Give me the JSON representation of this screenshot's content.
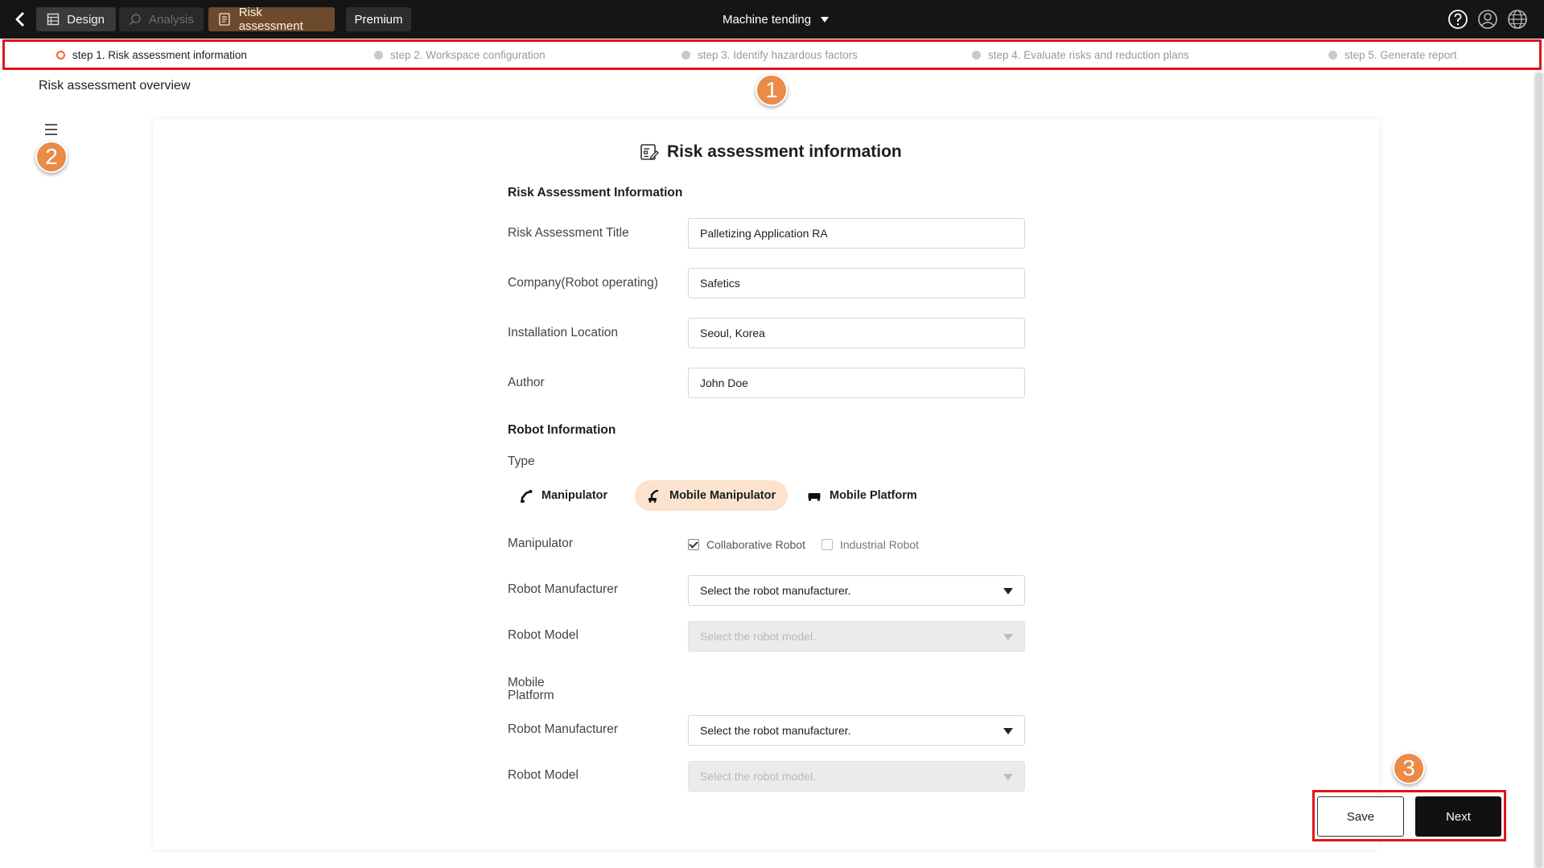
{
  "topbar": {
    "tabs": [
      {
        "label": "Design",
        "icon": "design-grid-icon"
      },
      {
        "label": "Analysis",
        "icon": "analysis-magnifier-icon"
      },
      {
        "label": "Risk assessment",
        "icon": "document-icon"
      },
      {
        "label": "Premium"
      }
    ],
    "project": "Machine tending",
    "icons": [
      "help-icon",
      "user-icon",
      "globe-icon"
    ]
  },
  "steps": [
    {
      "label": "step 1. Risk assessment information",
      "active": true
    },
    {
      "label": "step 2. Workspace configuration",
      "active": false
    },
    {
      "label": "step 3. Identify hazardous factors",
      "active": false
    },
    {
      "label": "step 4. Evaluate risks and reduction plans",
      "active": false
    },
    {
      "label": "step 5. Generate report",
      "active": false
    }
  ],
  "overview_title": "Risk assessment overview",
  "badges": [
    "1",
    "2",
    "3"
  ],
  "form": {
    "title": "Risk assessment information",
    "section_info": "Risk Assessment Information",
    "fields": [
      {
        "label": "Risk Assessment Title",
        "value": "Palletizing Application RA"
      },
      {
        "label": "Company(Robot operating)",
        "value": "Safetics"
      },
      {
        "label": "Installation Location",
        "value": "Seoul, Korea"
      },
      {
        "label": "Author",
        "value": "John Doe"
      }
    ],
    "section_robot": "Robot Information",
    "type_label": "Type",
    "types": [
      {
        "label": "Manipulator",
        "selected": false
      },
      {
        "label": "Mobile Manipulator",
        "selected": true
      },
      {
        "label": "Mobile Platform",
        "selected": false
      }
    ],
    "manipulator_label": "Manipulator",
    "manipulator_options": [
      {
        "label": "Collaborative Robot",
        "checked": true
      },
      {
        "label": "Industrial Robot",
        "checked": false
      }
    ],
    "manipulator_manufacturer_label": "Robot Manufacturer",
    "manipulator_manufacturer_placeholder": "Select the robot manufacturer.",
    "manipulator_model_label": "Robot Model",
    "manipulator_model_placeholder": "Select the robot model.",
    "mobile_platform_label": "Mobile Platform",
    "platform_manufacturer_label": "Robot Manufacturer",
    "platform_manufacturer_placeholder": "Select the robot manufacturer.",
    "platform_model_label": "Robot Model",
    "platform_model_placeholder": "Select the robot model."
  },
  "actions": {
    "save": "Save",
    "next": "Next"
  },
  "colors": {
    "accent": "#f06a23",
    "highlight_frame": "#e0151b",
    "risk_tab": "#6e4a2c",
    "selected_type": "#fbe3cf",
    "badge": "#ea8b47"
  }
}
